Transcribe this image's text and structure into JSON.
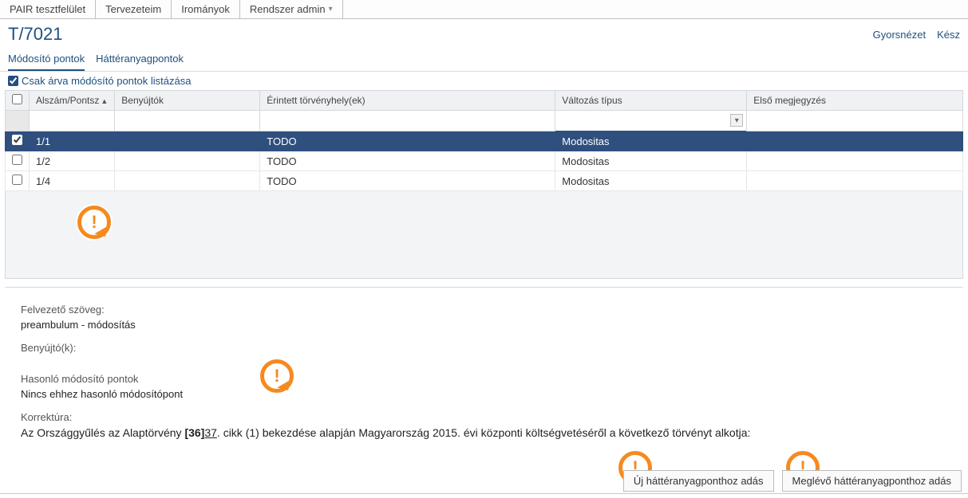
{
  "topnav": {
    "items": [
      "PAIR tesztfelület",
      "Tervezeteim",
      "Irományok",
      "Rendszer admin"
    ]
  },
  "header": {
    "title": "T/7021",
    "quickview": "Gyorsnézet",
    "done": "Kész"
  },
  "tabs": {
    "mod": "Módosító pontok",
    "hatter": "Háttéranyagpontok"
  },
  "filter": {
    "orphan_label": "Csak árva módósító pontok listázása",
    "orphan_checked": true
  },
  "columns": {
    "alszam": "Alszám/Pontsz",
    "benyujtok": "Benyújtók",
    "erintett": "Érintett törvényhely(ek)",
    "valtozas": "Változás típus",
    "elso": "Első megjegyzés"
  },
  "rows": [
    {
      "selected": true,
      "alszam": "1/1",
      "benyujtok": "",
      "erintett": "TODO",
      "valtozas": "Modositas",
      "elso": ""
    },
    {
      "selected": false,
      "alszam": "1/2",
      "benyujtok": "",
      "erintett": "TODO",
      "valtozas": "Modositas",
      "elso": ""
    },
    {
      "selected": false,
      "alszam": "1/4",
      "benyujtok": "",
      "erintett": "TODO",
      "valtozas": "Modositas",
      "elso": ""
    }
  ],
  "detail": {
    "felvezeto_label": "Felvezető szöveg:",
    "felvezeto_value": "preambulum - módosítás",
    "benyujto_label": "Benyújtó(k):",
    "hasonlo_label": "Hasonló módosító pontok",
    "hasonlo_value": "Nincs ehhez hasonló módosítópont",
    "korrektura_label": "Korrektúra:",
    "korrektura_pre": "Az Országgyűlés az Alaptörvény ",
    "korrektura_del": "[36]",
    "korrektura_ins": "37",
    "korrektura_post": ". cikk (1) bekezdése alapján Magyarország 2015. évi központi költségvetéséről a következő törvényt alkotja:"
  },
  "buttons": {
    "add_new": "Új háttéranyagponthoz adás",
    "add_existing": "Meglévő háttéranyagponthoz adás"
  },
  "callout_glyph": "!"
}
